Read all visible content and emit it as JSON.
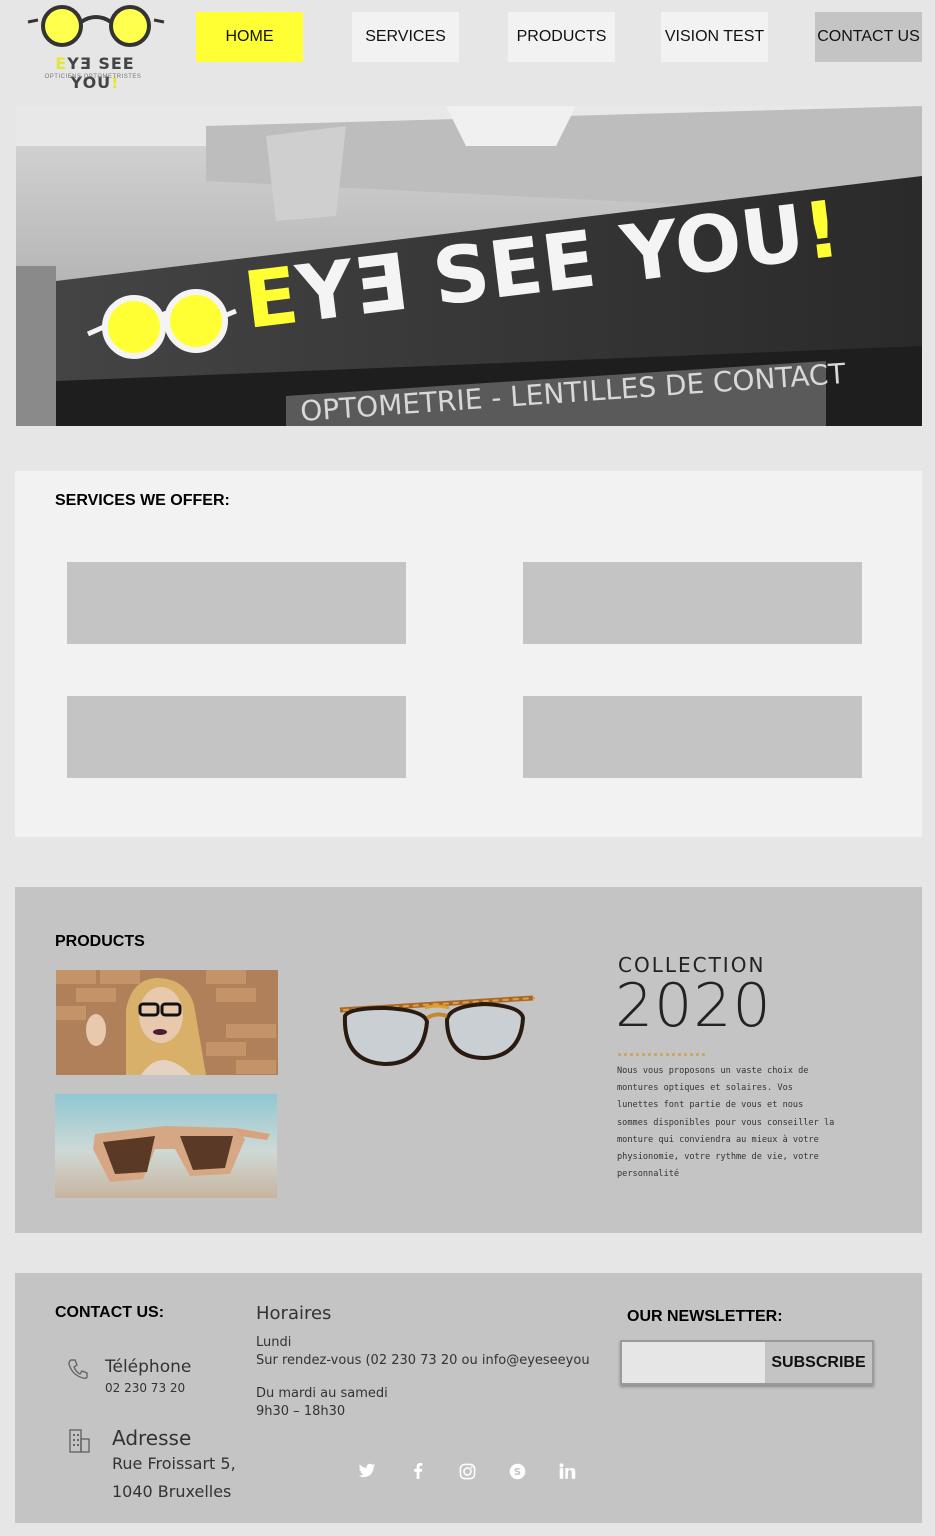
{
  "header": {
    "logo": {
      "brand_pre": "E",
      "brand_mid": "YƎ SEE YOU",
      "brand_post": "!",
      "tagline": "OPTICIENS OPTOMETRISTES"
    },
    "nav": [
      {
        "label": "HOME"
      },
      {
        "label": "SERVICES"
      },
      {
        "label": "PRODUCTS"
      },
      {
        "label": "VISION TEST"
      },
      {
        "label": "CONTACT US"
      }
    ]
  },
  "hero": {
    "sign_pre": "E",
    "sign_main": "YƎ SEE YOU",
    "sign_post": "!",
    "window_text": "OPTOMETRIE - LENTILLES DE CONTACT"
  },
  "services": {
    "title": "SERVICES WE OFFER:"
  },
  "products": {
    "title": "PRODUCTS",
    "collection_label": "COLLECTION",
    "collection_year": "2020",
    "description": "Nous vous proposons un vaste choix de montures optiques et solaires. Vos lunettes font partie de vous et nous sommes disponibles pour vous conseiller la monture qui conviendra au mieux à votre physionomie, votre rythme de vie, votre personnalité"
  },
  "footer": {
    "contact_title": "CONTACT US:",
    "phone_label": "Téléphone",
    "phone_value": "02 230 73 20",
    "address_label": "Adresse",
    "address_line1": "Rue Froissart 5,",
    "address_line2": "1040 Bruxelles",
    "hours_title": "Horaires",
    "hours_day1": "Lundi",
    "hours_day1_detail": "Sur rendez-vous (02 230 73 20 ou info@eyeseeyou",
    "hours_day2": "Du mardi au samedi",
    "hours_day2_detail": "9h30 – 18h30",
    "newsletter_title": "OUR NEWSLETTER:",
    "newsletter_placeholder": "",
    "subscribe_label": "SUBSCRIBE",
    "social": [
      "twitter-icon",
      "facebook-icon",
      "instagram-icon",
      "skype-icon",
      "linkedin-icon"
    ]
  },
  "colors": {
    "accent": "#ffff33",
    "background": "#e6e6e6",
    "panel": "#f2f2f2",
    "grey": "#c4c4c4"
  }
}
